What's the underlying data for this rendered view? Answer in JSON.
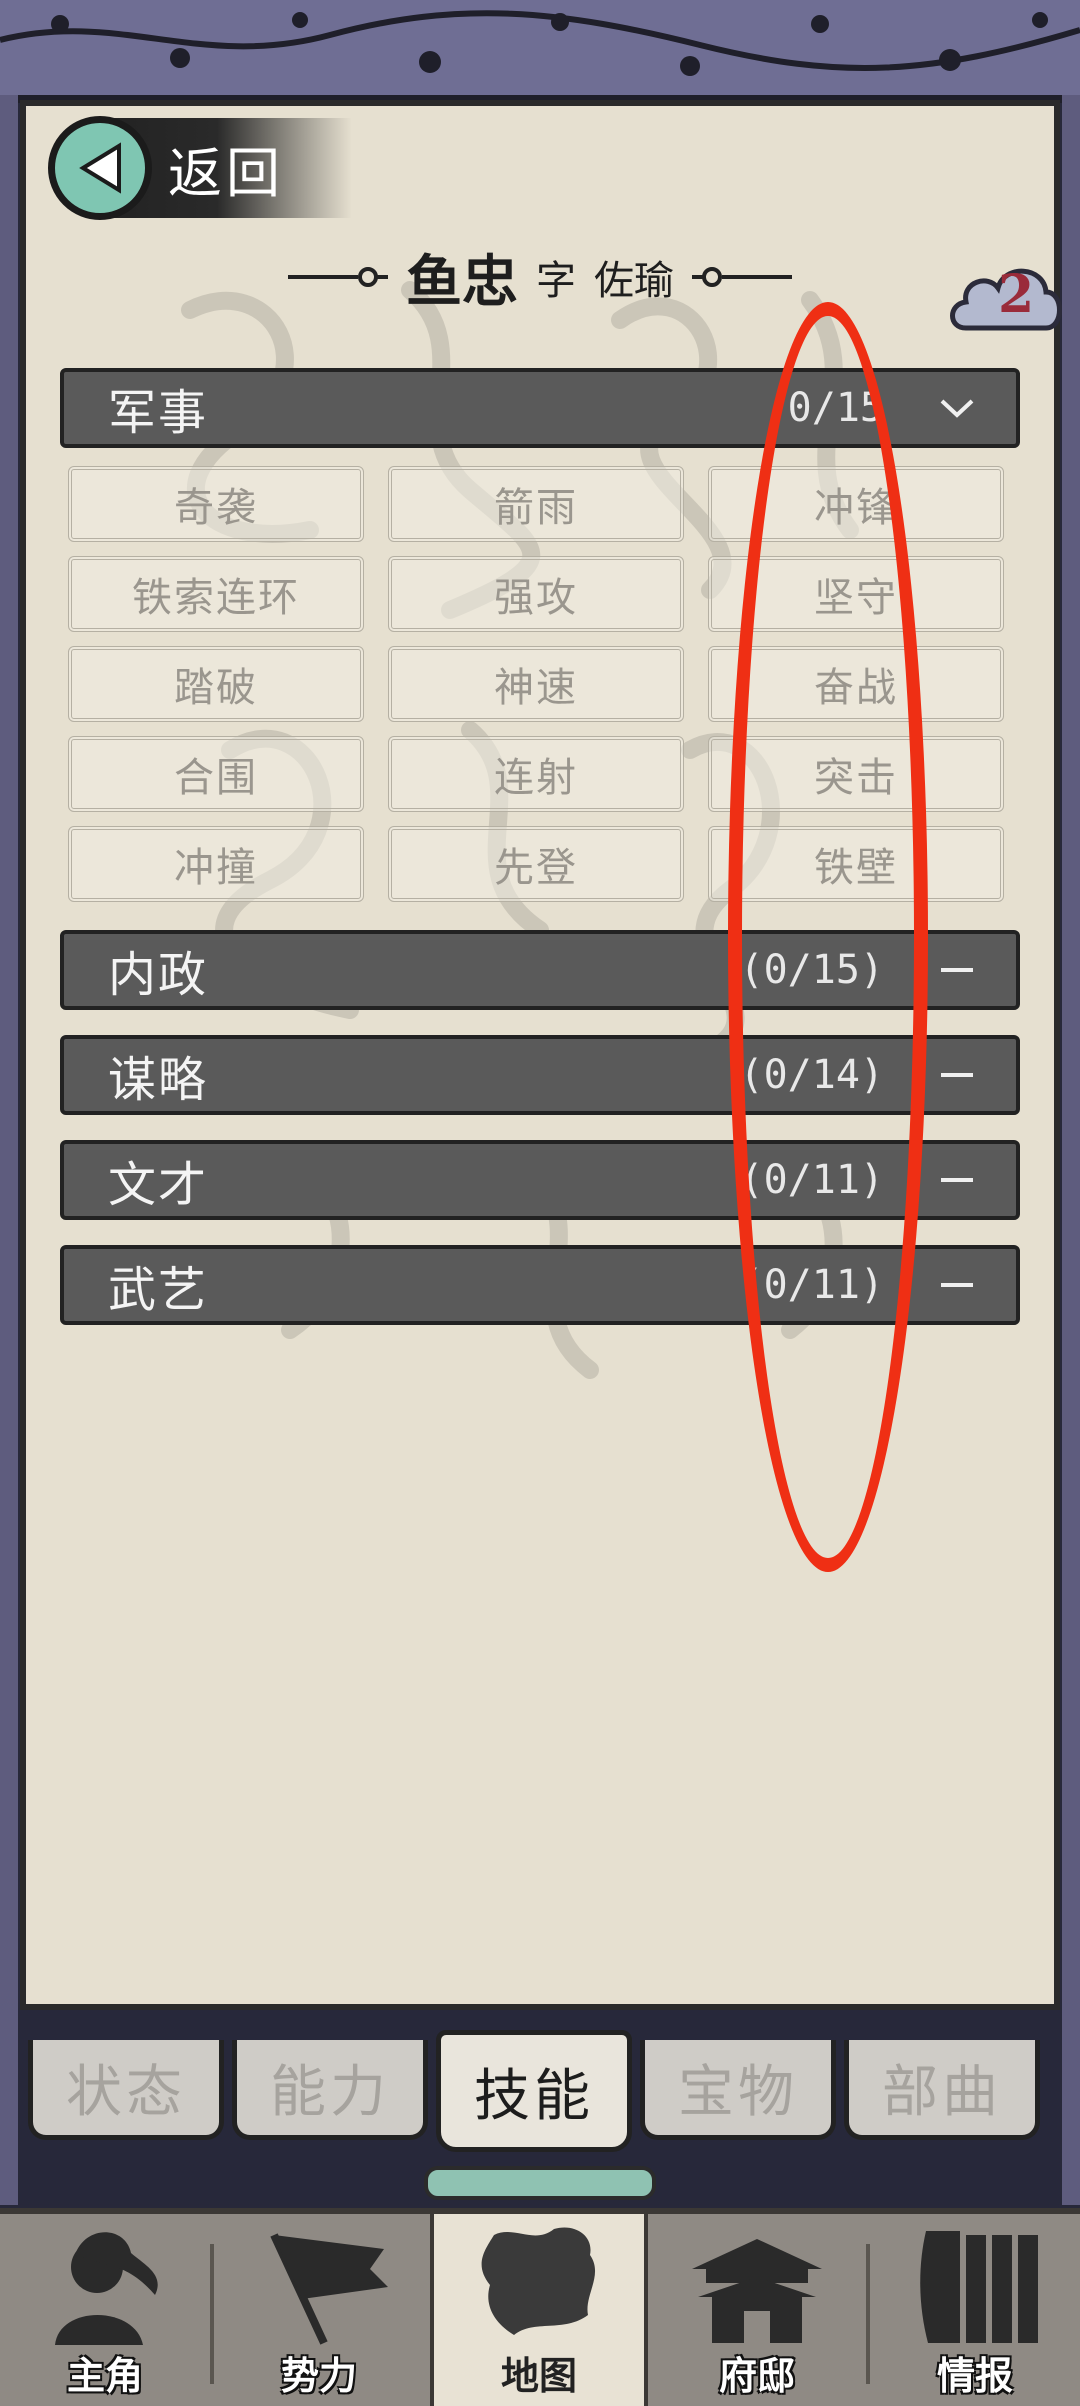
{
  "header": {
    "back_label": "返回",
    "name": "鱼忠",
    "zi_label": "字",
    "courtesy_name": "佐瑜",
    "badge_count": "2"
  },
  "sections": [
    {
      "title": "军事",
      "count": "0/15",
      "expanded": true,
      "skills": [
        "奇袭",
        "箭雨",
        "冲锋",
        "铁索连环",
        "强攻",
        "坚守",
        "踏破",
        "神速",
        "奋战",
        "合围",
        "连射",
        "突击",
        "冲撞",
        "先登",
        "铁壁"
      ]
    },
    {
      "title": "内政",
      "count": "(0/15)",
      "expanded": false
    },
    {
      "title": "谋略",
      "count": "(0/14)",
      "expanded": false
    },
    {
      "title": "文才",
      "count": "(0/11)",
      "expanded": false
    },
    {
      "title": "武艺",
      "count": "(0/11)",
      "expanded": false
    }
  ],
  "tabs": [
    {
      "label": "状态",
      "active": false
    },
    {
      "label": "能力",
      "active": false
    },
    {
      "label": "技能",
      "active": true
    },
    {
      "label": "宝物",
      "active": false
    },
    {
      "label": "部曲",
      "active": false
    }
  ],
  "bottom_nav": [
    {
      "label": "主角",
      "icon": "hero-icon"
    },
    {
      "label": "势力",
      "icon": "flag-icon"
    },
    {
      "label": "地图",
      "icon": "map-icon",
      "active": true
    },
    {
      "label": "府邸",
      "icon": "mansion-icon"
    },
    {
      "label": "情报",
      "icon": "scroll-icon"
    }
  ],
  "colors": {
    "accent_teal": "#7fc6b2",
    "section_bar": "#5a5a5a",
    "annotation_red": "#ef2f14",
    "paper": "#e6e0d0"
  }
}
